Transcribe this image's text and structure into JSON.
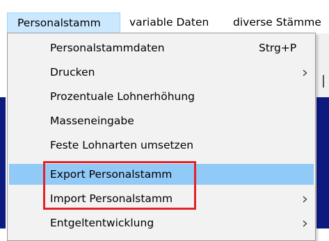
{
  "menubar": {
    "items": [
      {
        "label": "Personalstamm",
        "active": true
      },
      {
        "label": "variable Daten",
        "active": false
      },
      {
        "label": "diverse Stämme",
        "active": false
      }
    ]
  },
  "dropdown": {
    "items": [
      {
        "label": "Personalstammdaten",
        "shortcut": "Strg+P",
        "submenu": false,
        "highlighted": false
      },
      {
        "label": "Drucken",
        "shortcut": "",
        "submenu": true,
        "highlighted": false
      },
      {
        "label": "Prozentuale Lohnerhöhung",
        "shortcut": "",
        "submenu": false,
        "highlighted": false
      },
      {
        "label": "Masseneingabe",
        "shortcut": "",
        "submenu": false,
        "highlighted": false
      },
      {
        "label": "Feste Lohnarten umsetzen",
        "shortcut": "",
        "submenu": false,
        "highlighted": false
      },
      {
        "label": "Export Personalstamm",
        "shortcut": "",
        "submenu": false,
        "highlighted": true
      },
      {
        "label": "Import Personalstamm",
        "shortcut": "",
        "submenu": true,
        "highlighted": false
      },
      {
        "label": "Entgeltentwicklung",
        "shortcut": "",
        "submenu": true,
        "highlighted": false
      }
    ]
  },
  "colors": {
    "menubar_active_bg": "#cce8ff",
    "menu_highlight_bg": "#91c9f7",
    "menu_bg": "#f2f2f2",
    "annotation_red": "#e2222a",
    "backdrop_navy": "#0d1a80"
  },
  "icons": {
    "submenu_arrow": "chevron-right-icon"
  }
}
